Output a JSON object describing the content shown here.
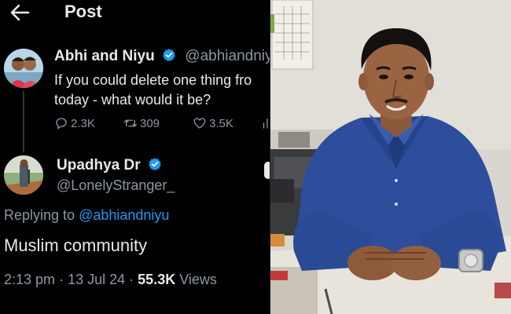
{
  "header": {
    "title": "Post",
    "back_icon": "arrow-left-icon"
  },
  "original_post": {
    "author_name": "Abhi and Niyu",
    "author_handle": "@abhiandniy",
    "verified_icon": "verified-badge-icon",
    "text_line1": "If you could delete one thing fro",
    "text_line2": "today - what would it be?",
    "stats": {
      "replies": "2.3K",
      "reposts": "309",
      "likes": "3.5K"
    }
  },
  "reply": {
    "author_name": "Upadhya Dr",
    "author_handle": "@LonelyStranger_",
    "replying_prefix": "Replying to",
    "replying_to": "@abhiandniyu",
    "text": "Muslim community",
    "time": "2:13 pm",
    "separator": "·",
    "date": "13 Jul 24",
    "views_count": "55.3K",
    "views_label": "Views"
  },
  "colors": {
    "background": "#000000",
    "text_primary": "#e7e9ea",
    "text_secondary": "#8b98a5",
    "accent_blue": "#1d9bf0",
    "shirt_blue": "#2d4e9c"
  },
  "photo": {
    "subject": "man-in-blue-shirt-at-desk"
  }
}
